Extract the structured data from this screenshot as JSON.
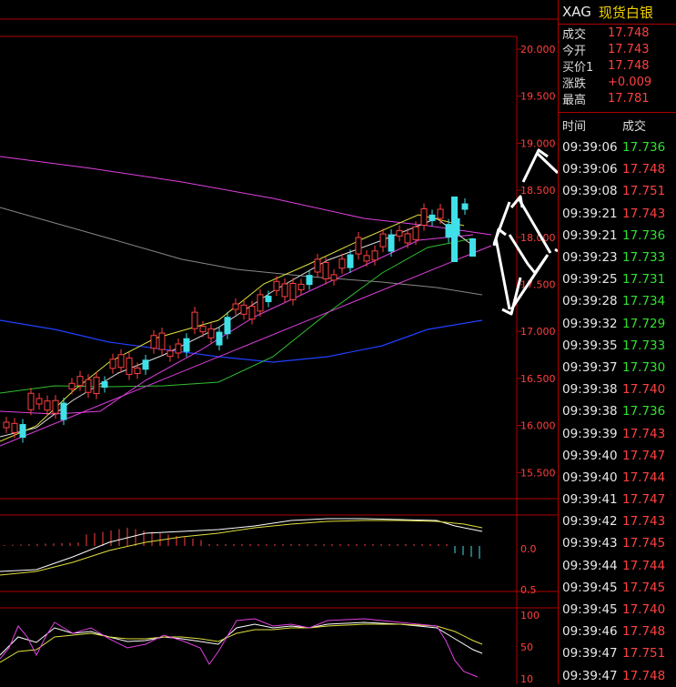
{
  "symbol": {
    "code": "XAG",
    "name": "现货白银"
  },
  "quote": [
    {
      "label": "成交",
      "value": "17.748"
    },
    {
      "label": "今开",
      "value": "17.743"
    },
    {
      "label": "买价1",
      "value": "17.748"
    },
    {
      "label": "涨跌",
      "value": "+0.009"
    },
    {
      "label": "最高",
      "value": "17.781"
    }
  ],
  "ticks_header": {
    "time": "时间",
    "price": "成交"
  },
  "ticks": [
    {
      "time": "09:39:06",
      "price": "17.736",
      "dir": "down"
    },
    {
      "time": "09:39:06",
      "price": "17.748",
      "dir": "up"
    },
    {
      "time": "09:39:08",
      "price": "17.751",
      "dir": "up"
    },
    {
      "time": "09:39:21",
      "price": "17.743",
      "dir": "up"
    },
    {
      "time": "09:39:21",
      "price": "17.736",
      "dir": "down"
    },
    {
      "time": "09:39:23",
      "price": "17.733",
      "dir": "down"
    },
    {
      "time": "09:39:25",
      "price": "17.731",
      "dir": "down"
    },
    {
      "time": "09:39:28",
      "price": "17.734",
      "dir": "down"
    },
    {
      "time": "09:39:32",
      "price": "17.729",
      "dir": "down"
    },
    {
      "time": "09:39:35",
      "price": "17.733",
      "dir": "down"
    },
    {
      "time": "09:39:37",
      "price": "17.730",
      "dir": "down"
    },
    {
      "time": "09:39:38",
      "price": "17.740",
      "dir": "up"
    },
    {
      "time": "09:39:38",
      "price": "17.736",
      "dir": "down"
    },
    {
      "time": "09:39:39",
      "price": "17.743",
      "dir": "up"
    },
    {
      "time": "09:39:40",
      "price": "17.747",
      "dir": "up"
    },
    {
      "time": "09:39:40",
      "price": "17.744",
      "dir": "up"
    },
    {
      "time": "09:39:41",
      "price": "17.747",
      "dir": "up"
    },
    {
      "time": "09:39:42",
      "price": "17.743",
      "dir": "up"
    },
    {
      "time": "09:39:43",
      "price": "17.745",
      "dir": "up"
    },
    {
      "time": "09:39:44",
      "price": "17.744",
      "dir": "up"
    },
    {
      "time": "09:39:45",
      "price": "17.745",
      "dir": "up"
    },
    {
      "time": "09:39:45",
      "price": "17.740",
      "dir": "up"
    },
    {
      "time": "09:39:46",
      "price": "17.748",
      "dir": "up"
    },
    {
      "time": "09:39:47",
      "price": "17.751",
      "dir": "up"
    },
    {
      "time": "09:39:47",
      "price": "17.748",
      "dir": "up"
    }
  ],
  "price_axis": [
    "20.000",
    "19.500",
    "19.000",
    "18.500",
    "18.000",
    "17.500",
    "17.000",
    "16.500",
    "16.000",
    "15.500"
  ],
  "macd_axis": [
    "0.0",
    "0.5"
  ],
  "kdj_axis": [
    "100",
    "50",
    "10"
  ],
  "colors": {
    "up": "#ff4040",
    "down": "#30e030",
    "frame": "#b00000",
    "candle_down": "#40e0e8"
  }
}
